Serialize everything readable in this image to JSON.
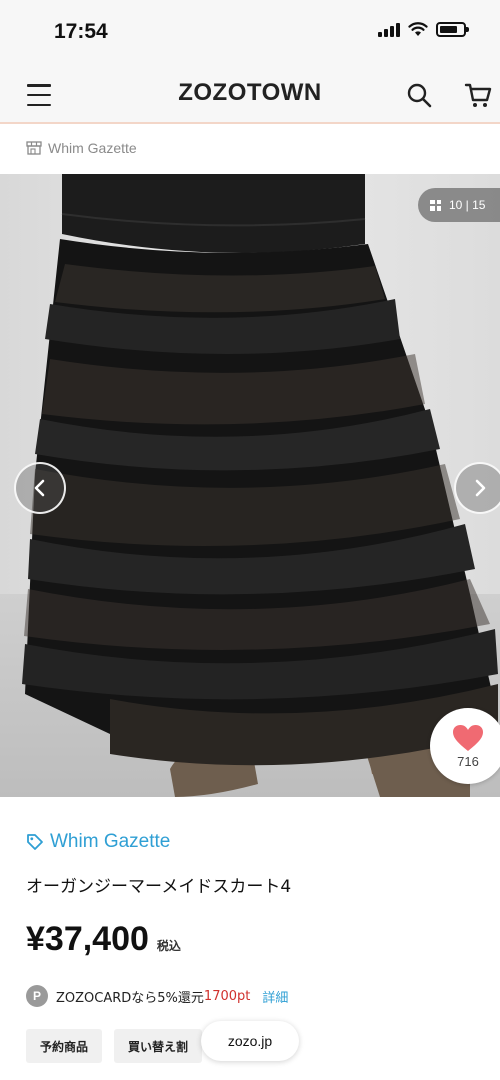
{
  "status_bar": {
    "time": "17:54"
  },
  "header": {
    "logo": "ZOZOTOWN"
  },
  "shop": {
    "name": "Whim Gazette"
  },
  "gallery": {
    "counter": "10 | 15",
    "current": 10,
    "total": 15,
    "like_count": "716"
  },
  "product": {
    "brand": "Whim Gazette",
    "name": "オーガンジーマーメイドスカート4",
    "price": "¥37,400",
    "tax_label": "税込",
    "points_badge": "P",
    "points_text": "ZOZOCARDなら5%還元",
    "points_value": "1700pt",
    "points_link": "詳細"
  },
  "tags": [
    "予約商品",
    "買い替え割"
  ],
  "browser": {
    "url": "zozo.jp"
  },
  "colors": {
    "accent": "#2f9fd4",
    "points_red": "#d0312d",
    "like_pink": "#f06a72"
  }
}
